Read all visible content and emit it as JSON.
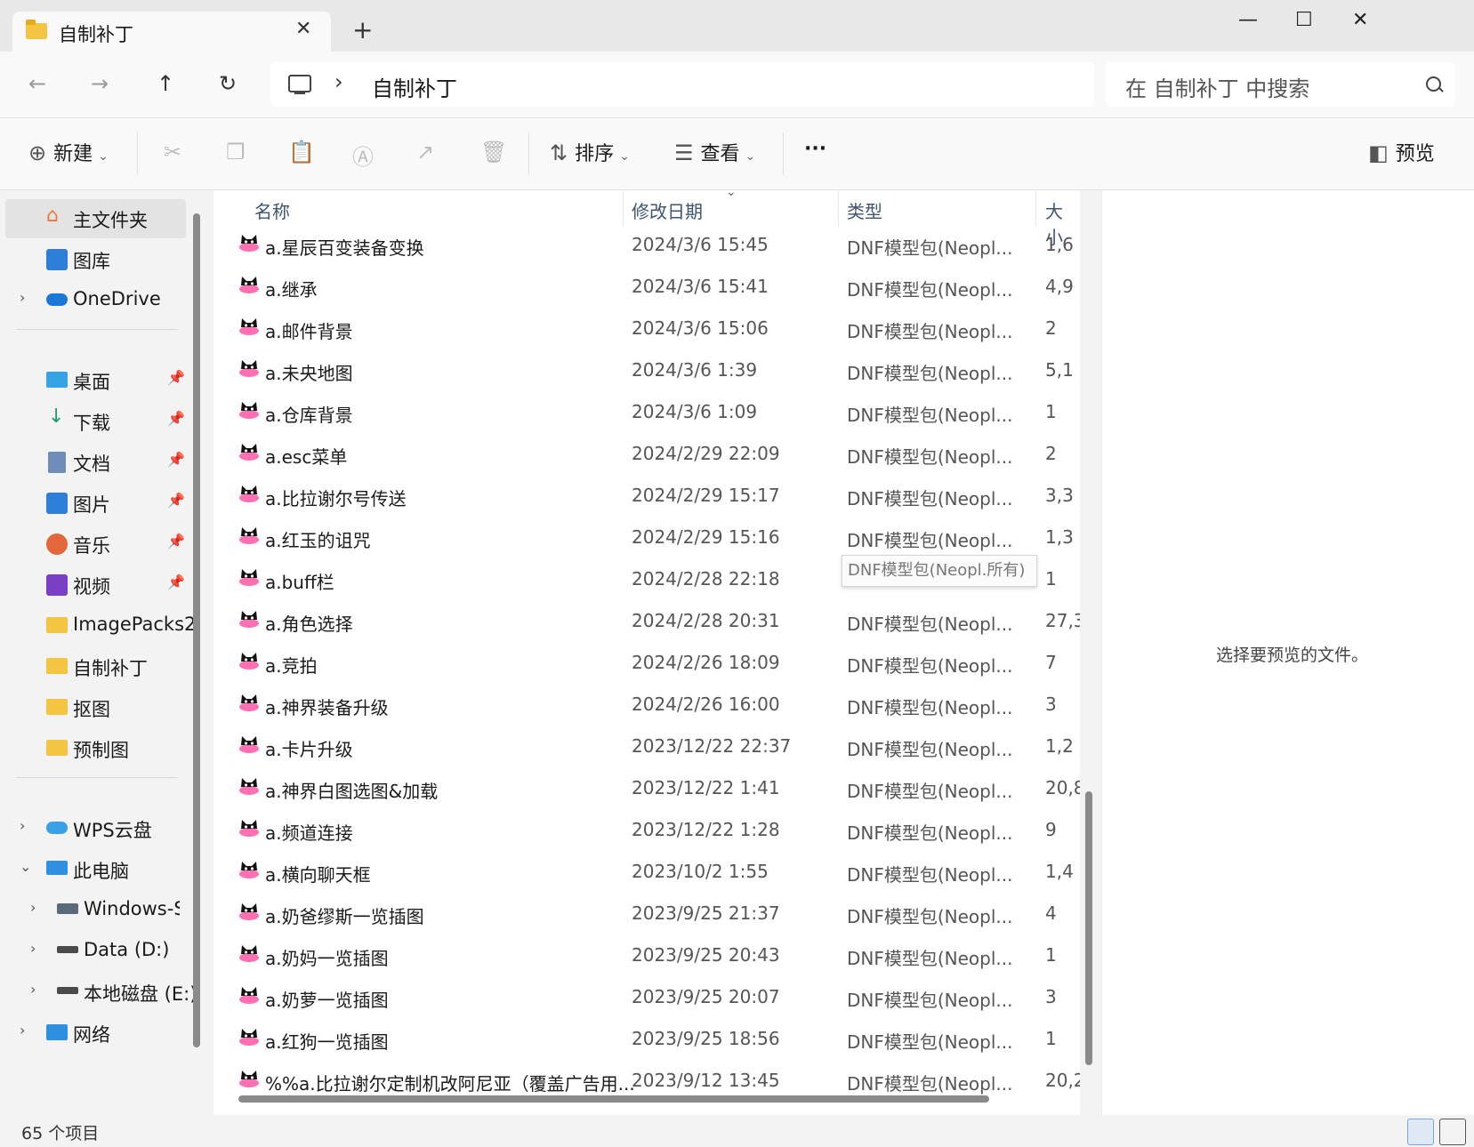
{
  "tab": {
    "title": "自制补丁",
    "close": "✕",
    "new_tab": "+"
  },
  "window_controls": {
    "minimize": "—",
    "maximize": "☐",
    "close": "✕"
  },
  "nav": {
    "back": "←",
    "forward": "→",
    "up": "↑",
    "refresh": "↻",
    "separator": "›"
  },
  "address": {
    "crumb": "自制补丁"
  },
  "search": {
    "placeholder": "在 自制补丁 中搜索"
  },
  "commands": {
    "new": "新建",
    "sort": "排序",
    "view": "查看",
    "more": "···",
    "preview": "预览"
  },
  "sidebar": {
    "home": "主文件夹",
    "gallery": "图库",
    "onedrive": "OneDrive",
    "desktop": "桌面",
    "downloads": "下载",
    "documents": "文档",
    "pictures": "图片",
    "music": "音乐",
    "videos": "视频",
    "imagepacks": "ImagePacks2",
    "custom_patch": "自制补丁",
    "cutout": "抠图",
    "preview_img": "预制图",
    "wps": "WPS云盘",
    "this_pc": "此电脑",
    "windows": "Windows-SSD",
    "data_d": "Data (D:)",
    "local_e": "本地磁盘 (E:)",
    "network": "网络"
  },
  "columns": {
    "name": "名称",
    "date": "修改日期",
    "type": "类型",
    "size": "大小"
  },
  "files": [
    {
      "name": "a.星辰百变装备变换",
      "date": "2024/3/6 15:45",
      "type": "DNF模型包(Neopl...",
      "size": "1,6"
    },
    {
      "name": "a.继承",
      "date": "2024/3/6 15:41",
      "type": "DNF模型包(Neopl...",
      "size": "4,9"
    },
    {
      "name": "a.邮件背景",
      "date": "2024/3/6 15:06",
      "type": "DNF模型包(Neopl...",
      "size": "2"
    },
    {
      "name": "a.未央地图",
      "date": "2024/3/6 1:39",
      "type": "DNF模型包(Neopl...",
      "size": "5,1"
    },
    {
      "name": "a.仓库背景",
      "date": "2024/3/6 1:09",
      "type": "DNF模型包(Neopl...",
      "size": "1"
    },
    {
      "name": "a.esc菜单",
      "date": "2024/2/29 22:09",
      "type": "DNF模型包(Neopl...",
      "size": "2"
    },
    {
      "name": "a.比拉谢尔号传送",
      "date": "2024/2/29 15:17",
      "type": "DNF模型包(Neopl...",
      "size": "3,3"
    },
    {
      "name": "a.红玉的诅咒",
      "date": "2024/2/29 15:16",
      "type": "DNF模型包(Neopl...",
      "size": "1,3"
    },
    {
      "name": "a.buff栏",
      "date": "2024/2/28 22:18",
      "type": "",
      "size": "1"
    },
    {
      "name": "a.角色选择",
      "date": "2024/2/28 20:31",
      "type": "DNF模型包(Neopl...",
      "size": "27,3"
    },
    {
      "name": "a.竞拍",
      "date": "2024/2/26 18:09",
      "type": "DNF模型包(Neopl...",
      "size": "7"
    },
    {
      "name": "a.神界装备升级",
      "date": "2024/2/26 16:00",
      "type": "DNF模型包(Neopl...",
      "size": "3"
    },
    {
      "name": "a.卡片升级",
      "date": "2023/12/22 22:37",
      "type": "DNF模型包(Neopl...",
      "size": "1,2"
    },
    {
      "name": "a.神界白图选图&加载",
      "date": "2023/12/22 1:41",
      "type": "DNF模型包(Neopl...",
      "size": "20,8"
    },
    {
      "name": "a.频道连接",
      "date": "2023/12/22 1:28",
      "type": "DNF模型包(Neopl...",
      "size": "9"
    },
    {
      "name": "a.横向聊天框",
      "date": "2023/10/2 1:55",
      "type": "DNF模型包(Neopl...",
      "size": "1,4"
    },
    {
      "name": "a.奶爸缪斯一览插图",
      "date": "2023/9/25 21:37",
      "type": "DNF模型包(Neopl...",
      "size": "4"
    },
    {
      "name": "a.奶妈一览插图",
      "date": "2023/9/25 20:43",
      "type": "DNF模型包(Neopl...",
      "size": "1"
    },
    {
      "name": "a.奶萝一览插图",
      "date": "2023/9/25 20:07",
      "type": "DNF模型包(Neopl...",
      "size": "3"
    },
    {
      "name": "a.红狗一览插图",
      "date": "2023/9/25 18:56",
      "type": "DNF模型包(Neopl...",
      "size": "1"
    },
    {
      "name": "%%a.比拉谢尔定制机改阿尼亚（覆盖广告用...",
      "date": "2023/9/12 13:45",
      "type": "DNF模型包(Neopl...",
      "size": "20,2"
    }
  ],
  "tooltip": "DNF模型包(Neopl.所有)",
  "preview_pane": {
    "message": "选择要预览的文件。"
  },
  "status": {
    "count": "65 个项目"
  },
  "colors": {
    "folder": "#f4c542",
    "file_icon": "#ff6fb4",
    "accent": "#0067c0"
  }
}
